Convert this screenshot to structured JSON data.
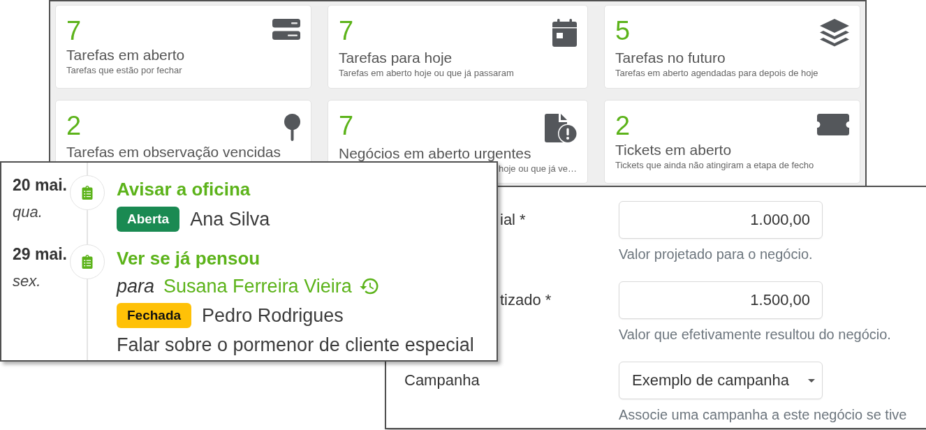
{
  "dashboard": {
    "cards": [
      {
        "count": "7",
        "title": "Tarefas em aberto",
        "description": "Tarefas que estão por fechar",
        "description_covered": false
      },
      {
        "count": "7",
        "title": "Tarefas para hoje",
        "description": "Tarefas em aberto hoje ou que já passaram",
        "description_covered": false
      },
      {
        "count": "5",
        "title": "Tarefas no futuro",
        "description": "Tarefas em aberto agendadas para depois de hoje",
        "description_covered": false
      },
      {
        "count": "2",
        "title": "Tarefas em observação vencidas"
      },
      {
        "count": "7",
        "title": "Negócios em aberto urgentes",
        "description": "hoje ou que já ve…",
        "description_covered": true
      },
      {
        "count": "2",
        "title": "Tickets em aberto",
        "description": "Tickets que ainda não atingiram a etapa de fecho",
        "description_covered": false
      }
    ]
  },
  "timeline": {
    "entries": [
      {
        "date": "20 mai.",
        "weekday": "qua.",
        "title": "Avisar a oficina",
        "status": {
          "label": "Aberta",
          "color": "#1a8a52"
        },
        "person": "Ana Silva"
      },
      {
        "date": "29 mai.",
        "weekday": "sex.",
        "title": "Ver se já pensou",
        "recipient": {
          "prefix": "para",
          "name": "Susana Ferreira Vieira"
        },
        "status": {
          "label": "Fechada",
          "color": "#ffc107"
        },
        "person": "Pedro Rodrigues",
        "note": "Falar sobre o pormenor de cliente especial"
      }
    ]
  },
  "form": {
    "fields": [
      {
        "kind": "input",
        "label": "ial *",
        "label_covered": true,
        "value": "1.000,00",
        "help": "Valor projetado para o negócio."
      },
      {
        "kind": "input",
        "label": "tizado *",
        "label_covered": true,
        "value": "1.500,00",
        "help": "Valor que efetivamente resultou do negócio."
      },
      {
        "kind": "select",
        "label": "Campanha",
        "value": "Exemplo de campanha",
        "help": "Associe uma campanha a este negócio se tive"
      }
    ]
  }
}
